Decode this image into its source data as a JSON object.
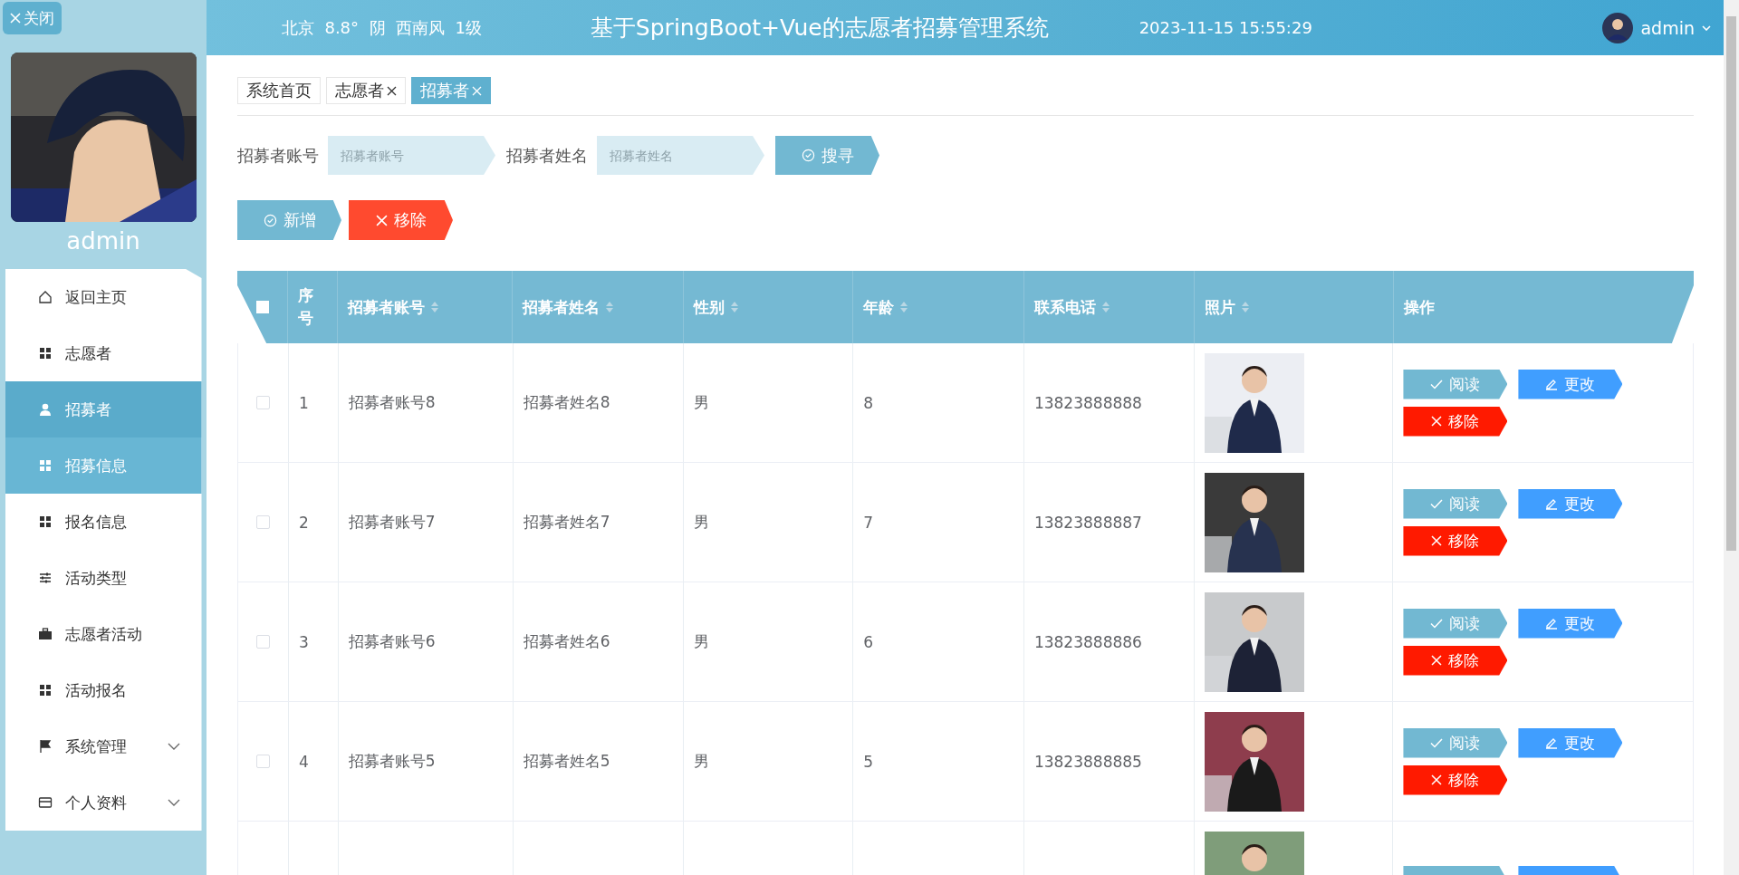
{
  "sidebar": {
    "close_label": "关闭",
    "user_name": "admin",
    "menu": [
      {
        "label": "返回主页",
        "selected": false,
        "hovered": false,
        "has_submenu": false
      },
      {
        "label": "志愿者",
        "selected": false,
        "hovered": false,
        "has_submenu": false
      },
      {
        "label": "招募者",
        "selected": true,
        "hovered": false,
        "has_submenu": false
      },
      {
        "label": "招募信息",
        "selected": false,
        "hovered": true,
        "has_submenu": false
      },
      {
        "label": "报名信息",
        "selected": false,
        "hovered": false,
        "has_submenu": false
      },
      {
        "label": "活动类型",
        "selected": false,
        "hovered": false,
        "has_submenu": false
      },
      {
        "label": "志愿者活动",
        "selected": false,
        "hovered": false,
        "has_submenu": false
      },
      {
        "label": "活动报名",
        "selected": false,
        "hovered": false,
        "has_submenu": false
      },
      {
        "label": "系统管理",
        "selected": false,
        "hovered": false,
        "has_submenu": true
      },
      {
        "label": "个人资料",
        "selected": false,
        "hovered": false,
        "has_submenu": true
      }
    ]
  },
  "header": {
    "weather": "北京  8.8°  阴  西南风  1级",
    "title": "基于SpringBoot+Vue的志愿者招募管理系统",
    "datetime": "2023-11-15 15:55:29",
    "user": "admin"
  },
  "tabs": [
    {
      "label": "系统首页",
      "closable": false,
      "selected": false
    },
    {
      "label": "志愿者",
      "closable": true,
      "selected": false
    },
    {
      "label": "招募者",
      "closable": true,
      "selected": true
    }
  ],
  "search": {
    "fields": [
      {
        "label": "招募者账号",
        "placeholder": "招募者账号"
      },
      {
        "label": "招募者姓名",
        "placeholder": "招募者姓名"
      }
    ],
    "button": "搜寻"
  },
  "actions": [
    {
      "label": "新增",
      "kind": "add"
    },
    {
      "label": "移除",
      "kind": "remove"
    }
  ],
  "table": {
    "select_all_checked": false,
    "columns": [
      {
        "label": "序号",
        "sortable": false
      },
      {
        "label": "招募者账号",
        "sortable": true
      },
      {
        "label": "招募者姓名",
        "sortable": true
      },
      {
        "label": "性别",
        "sortable": true
      },
      {
        "label": "年龄",
        "sortable": true
      },
      {
        "label": "联系电话",
        "sortable": true
      },
      {
        "label": "照片",
        "sortable": true
      },
      {
        "label": "操作",
        "sortable": false
      }
    ],
    "rows": [
      {
        "checked": false,
        "index": "1",
        "account": "招募者账号8",
        "name": "招募者姓名8",
        "gender": "男",
        "age": "8",
        "phone": "13823888888",
        "photo": {
          "kind": "picture"
        },
        "actions": [
          {
            "label": "阅读",
            "kind": "read"
          },
          {
            "label": "更改",
            "kind": "edit"
          },
          {
            "label": "移除",
            "kind": "remove"
          }
        ]
      },
      {
        "checked": false,
        "index": "2",
        "account": "招募者账号7",
        "name": "招募者姓名7",
        "gender": "男",
        "age": "7",
        "phone": "13823888887",
        "photo": {
          "kind": "picture"
        },
        "actions": [
          {
            "label": "阅读",
            "kind": "read"
          },
          {
            "label": "更改",
            "kind": "edit"
          },
          {
            "label": "移除",
            "kind": "remove"
          }
        ]
      },
      {
        "checked": false,
        "index": "3",
        "account": "招募者账号6",
        "name": "招募者姓名6",
        "gender": "男",
        "age": "6",
        "phone": "13823888886",
        "photo": {
          "kind": "picture"
        },
        "actions": [
          {
            "label": "阅读",
            "kind": "read"
          },
          {
            "label": "更改",
            "kind": "edit"
          },
          {
            "label": "移除",
            "kind": "remove"
          }
        ]
      },
      {
        "checked": false,
        "index": "4",
        "account": "招募者账号5",
        "name": "招募者姓名5",
        "gender": "男",
        "age": "5",
        "phone": "13823888885",
        "photo": {
          "kind": "picture"
        },
        "actions": [
          {
            "label": "阅读",
            "kind": "read"
          },
          {
            "label": "更改",
            "kind": "edit"
          },
          {
            "label": "移除",
            "kind": "remove"
          }
        ]
      },
      {
        "photo": {
          "kind": "picture"
        },
        "actions": [
          {
            "kind": "read"
          },
          {
            "kind": "edit"
          }
        ]
      }
    ]
  }
}
